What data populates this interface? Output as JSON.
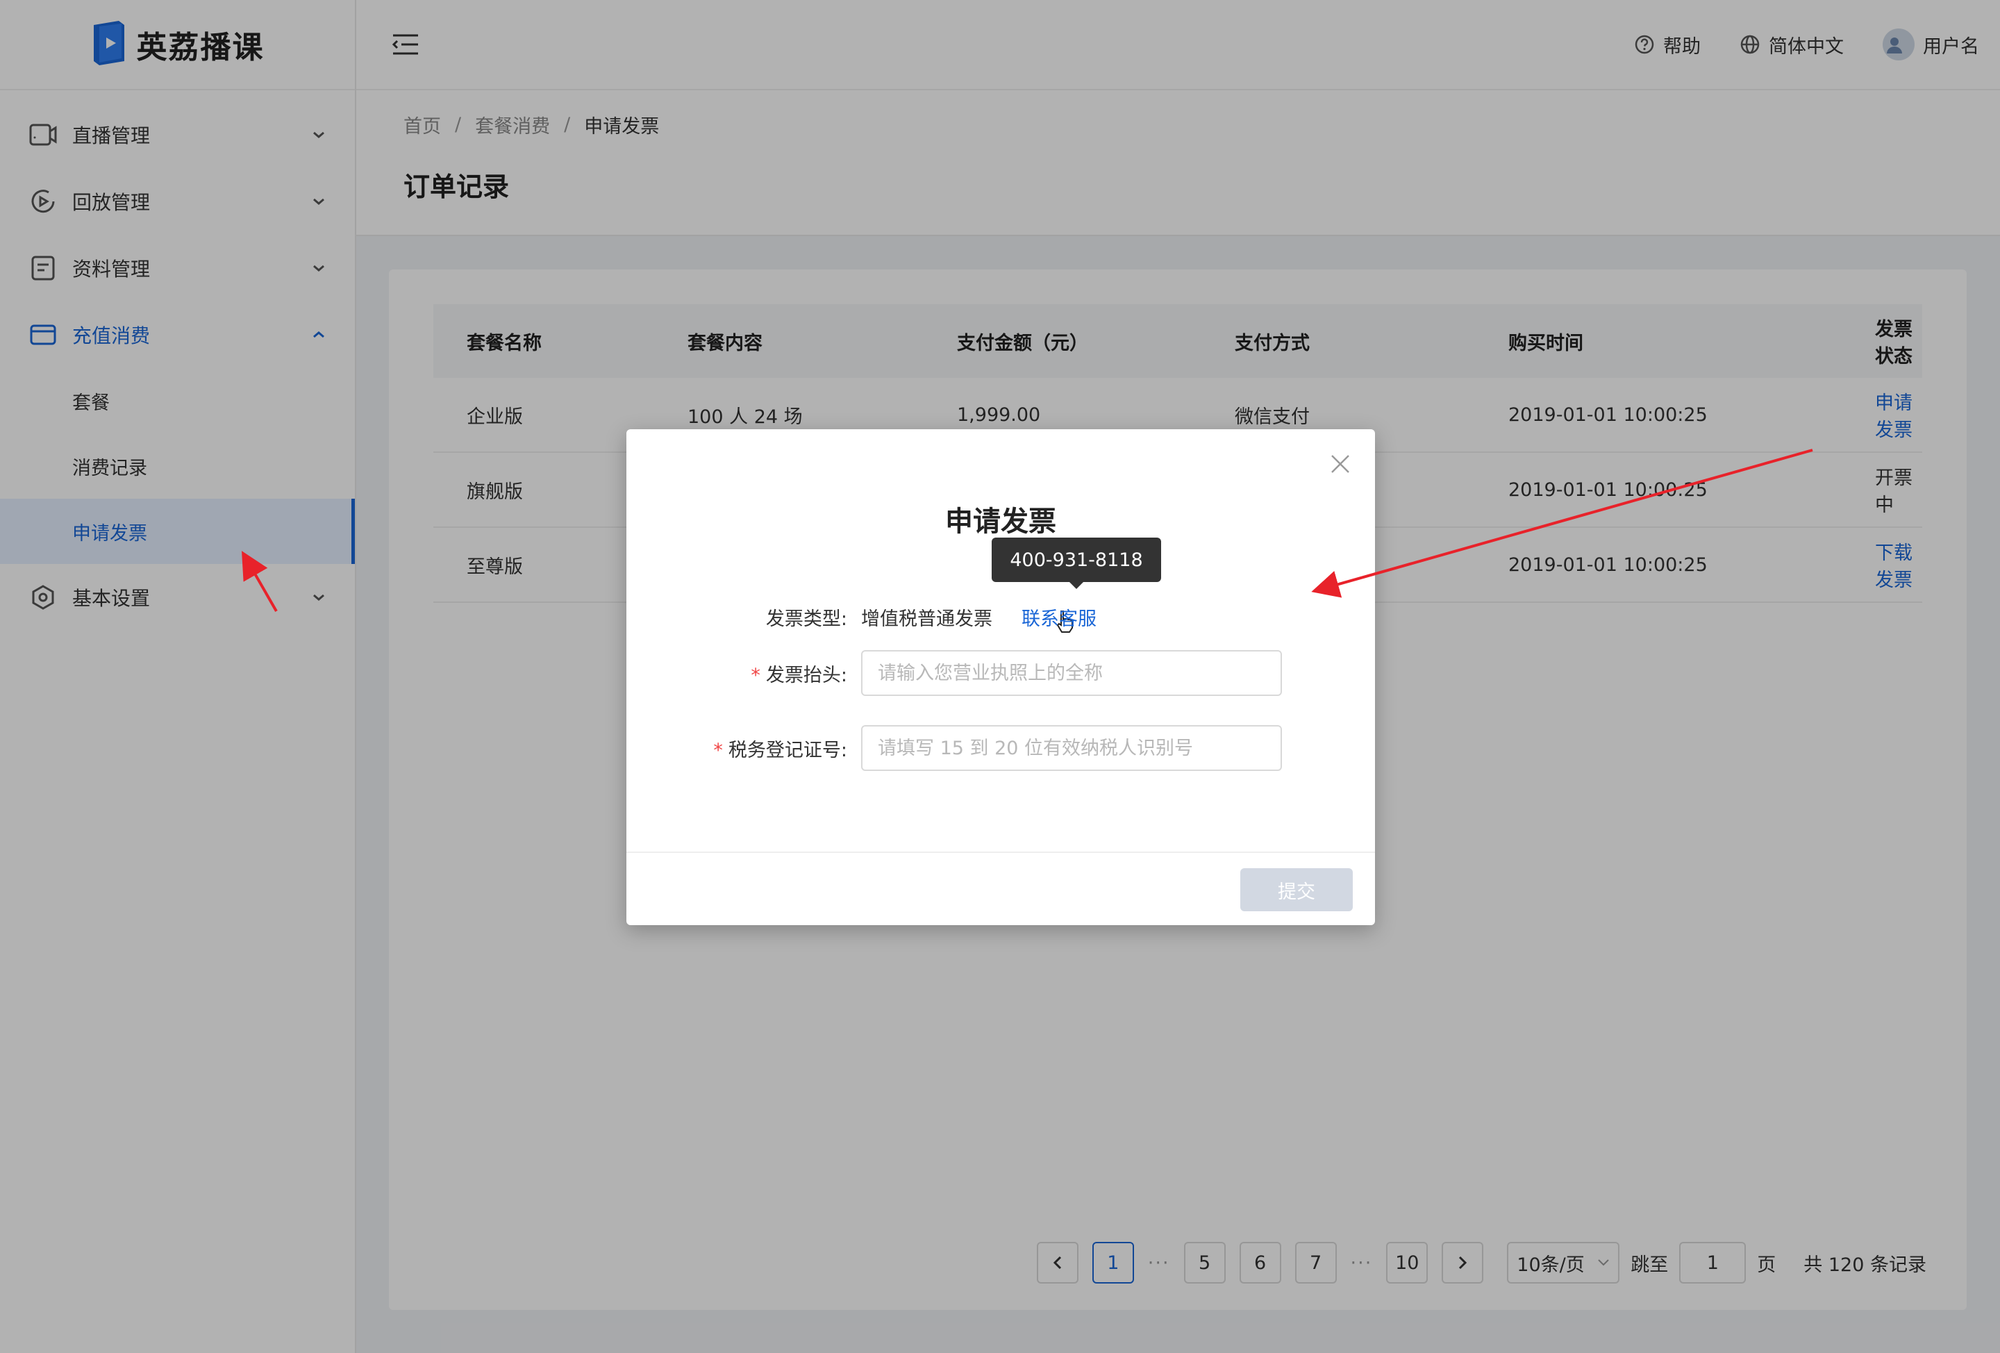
{
  "app": {
    "logo_text": "英荔播课"
  },
  "header": {
    "help_label": "帮助",
    "language_label": "简体中文",
    "user_label": "用户名"
  },
  "sidebar": {
    "items": [
      {
        "label": "直播管理",
        "icon": "video-camera-icon"
      },
      {
        "label": "回放管理",
        "icon": "replay-icon"
      },
      {
        "label": "资料管理",
        "icon": "document-icon"
      },
      {
        "label": "充值消费",
        "icon": "card-icon",
        "children": [
          {
            "label": "套餐"
          },
          {
            "label": "消费记录"
          },
          {
            "label": "申请发票"
          }
        ]
      },
      {
        "label": "基本设置",
        "icon": "settings-icon"
      }
    ]
  },
  "breadcrumb": {
    "home": "首页",
    "parent": "套餐消费",
    "current": "申请发票"
  },
  "page_title": "订单记录",
  "table": {
    "columns": [
      "套餐名称",
      "套餐内容",
      "支付金额（元）",
      "支付方式",
      "购买时间",
      "发票状态"
    ],
    "rows": [
      {
        "name": "企业版",
        "content": "100 人 24 场",
        "amount": "1,999.00",
        "method": "微信支付",
        "time": "2019-01-01 10:00:25",
        "status": "申请发票"
      },
      {
        "name": "旗舰版",
        "content": "",
        "amount": "",
        "method": "",
        "time": "2019-01-01 10:00:25",
        "status": "开票中"
      },
      {
        "name": "至尊版",
        "content": "",
        "amount": "",
        "method": "",
        "time": "2019-01-01 10:00:25",
        "status": "下载发票"
      }
    ]
  },
  "pagination": {
    "pages": [
      "1",
      "5",
      "6",
      "7",
      "10"
    ],
    "ellipsis": "···",
    "page_size": "10条/页",
    "jump_label": "跳至",
    "jump_value": "1",
    "page_unit": "页",
    "total": "共 120 条记录"
  },
  "modal": {
    "title": "申请发票",
    "invoice_type_label": "发票类型:",
    "invoice_type_value": "增值税普通发票",
    "contact_link": "联系客服",
    "tooltip": "400-931-8118",
    "title_label": "发票抬头:",
    "title_placeholder": "请输入您营业执照上的全称",
    "tax_label": "税务登记证号:",
    "tax_placeholder": "请填写 15 到 20 位有效纳税人识别号",
    "submit": "提交"
  },
  "colors": {
    "primary": "#1a66d6",
    "required": "#f04545",
    "annotation": "#e8222a"
  }
}
